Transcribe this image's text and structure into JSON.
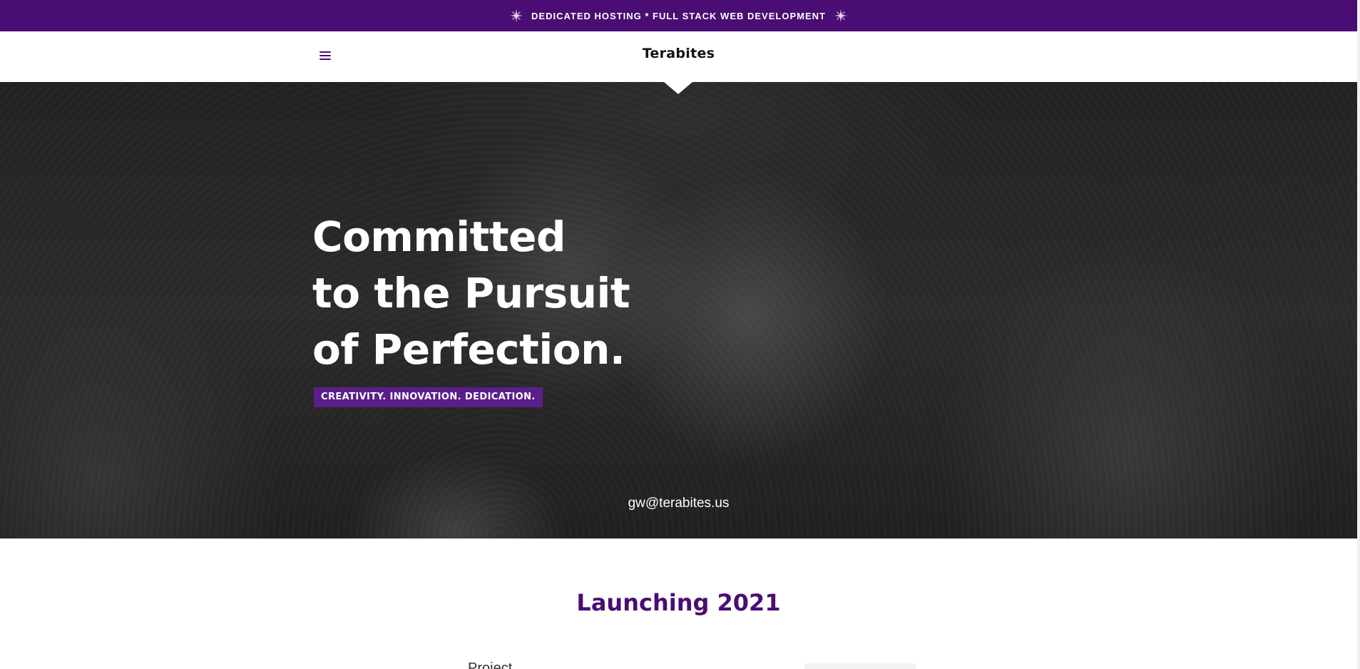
{
  "topbar": {
    "text": "DEDICATED HOSTING * FULL STACK WEB DEVELOPMENT",
    "icons": [
      "sparkle-icon",
      "sparkle-icon"
    ],
    "background": "#4a0d73"
  },
  "header": {
    "menu_icon": "hamburger-menu-icon",
    "logo": "Terabites"
  },
  "hero": {
    "headline_lines": [
      "Committed",
      "to the Pursuit",
      "of Perfection."
    ],
    "tagline": "CREATIVITY. INNOVATION. DEDICATION.",
    "email": "gw@terabites.us",
    "tagline_color": "#5b1f8c"
  },
  "main": {
    "section_title": "Launching 2021",
    "partial_text": "Project",
    "accent_color": "#4a0d73"
  }
}
